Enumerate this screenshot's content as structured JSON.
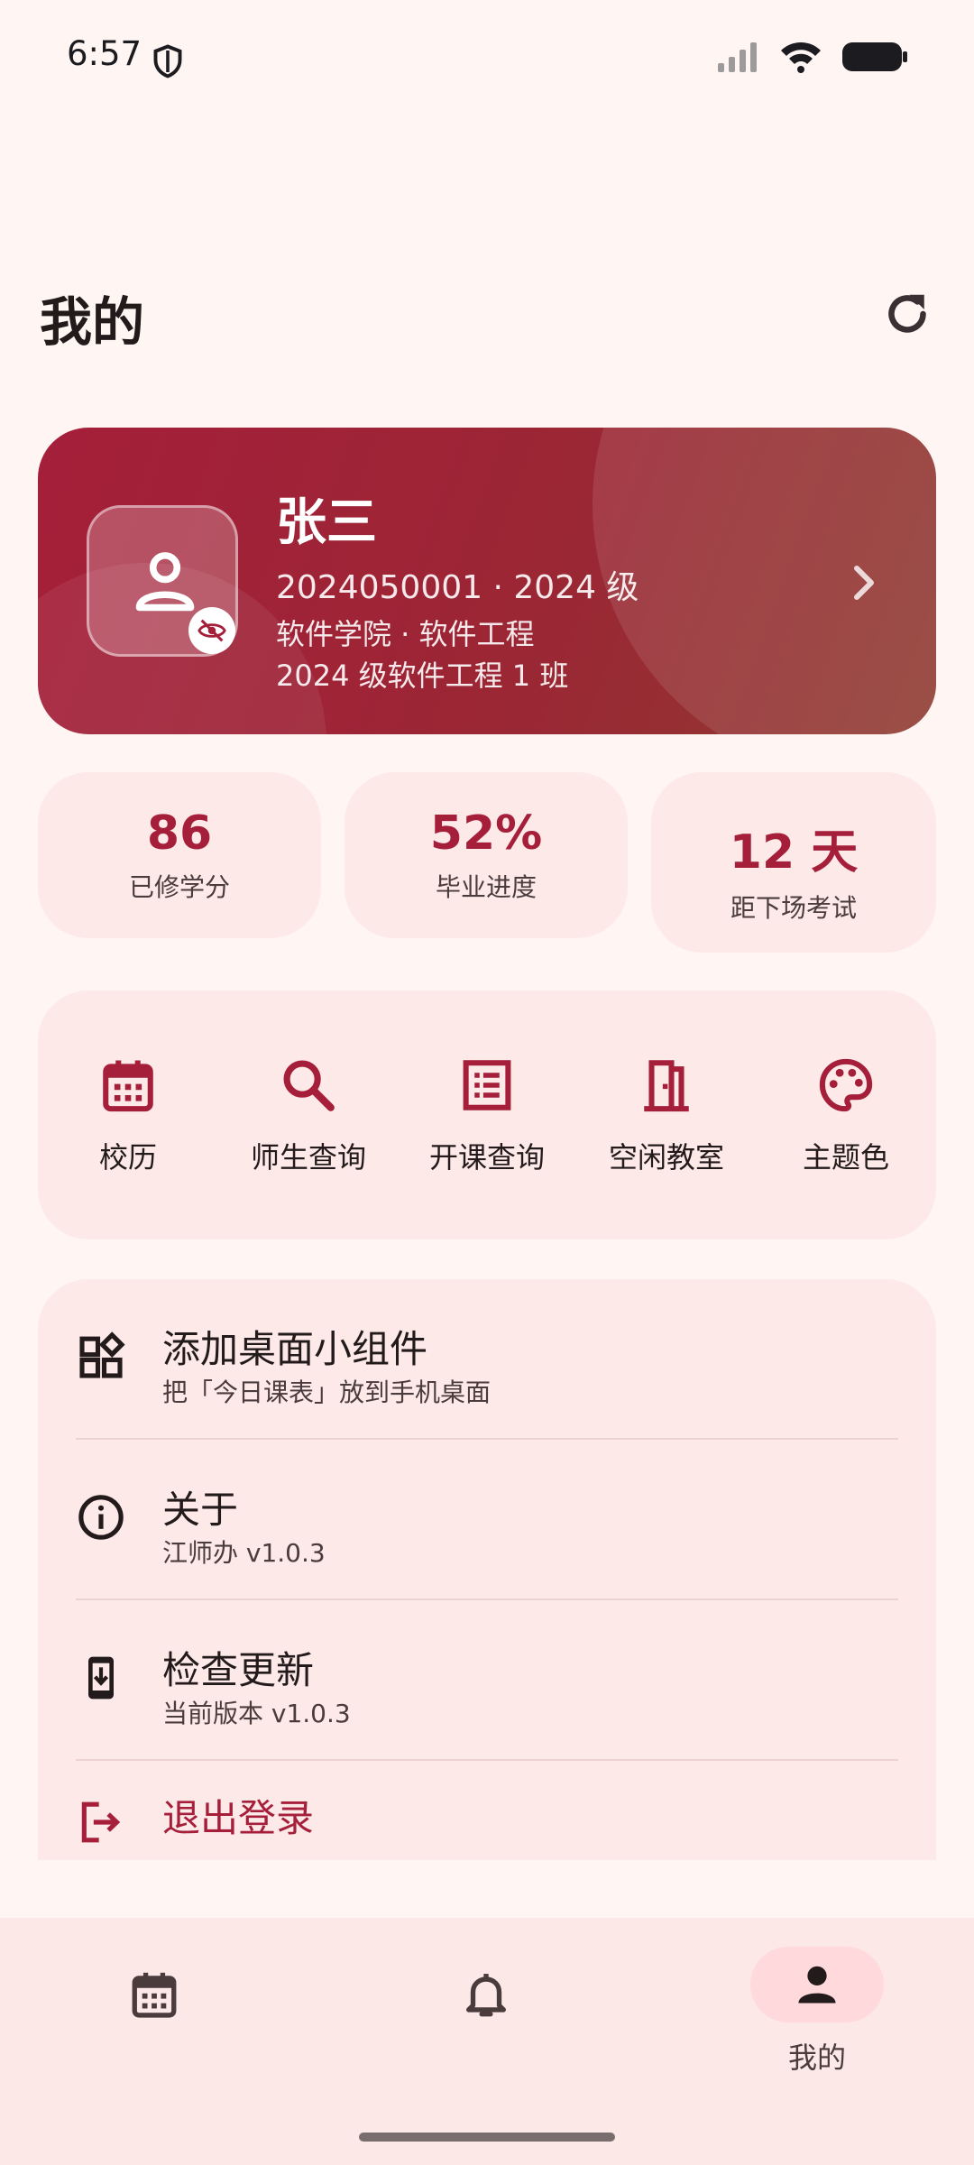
{
  "status_bar": {
    "time": "6:57"
  },
  "header": {
    "title": "我的"
  },
  "profile": {
    "name": "张三",
    "line1": "2024050001 · 2024 级",
    "line2": "软件学院 · 软件工程",
    "line3": "2024 级软件工程 1 班"
  },
  "stats": [
    {
      "value": "86",
      "label": "已修学分"
    },
    {
      "value": "52%",
      "label": "毕业进度"
    },
    {
      "value": "12 天",
      "label": "距下场考试"
    }
  ],
  "quick_actions": [
    {
      "label": "校历",
      "icon": "calendar-icon"
    },
    {
      "label": "师生查询",
      "icon": "search-icon"
    },
    {
      "label": "开课查询",
      "icon": "list-icon"
    },
    {
      "label": "空闲教室",
      "icon": "door-icon"
    },
    {
      "label": "主题色",
      "icon": "palette-icon"
    }
  ],
  "menu": [
    {
      "title": "添加桌面小组件",
      "subtitle": "把「今日课表」放到手机桌面",
      "icon": "widgets-icon"
    },
    {
      "title": "关于",
      "subtitle": "江师办 v1.0.3",
      "icon": "info-icon"
    },
    {
      "title": "检查更新",
      "subtitle": "当前版本 v1.0.3",
      "icon": "phone-download-icon"
    },
    {
      "title": "退出登录",
      "subtitle": "",
      "icon": "logout-icon"
    }
  ],
  "bottom_nav": {
    "items": [
      {
        "icon": "calendar-icon"
      },
      {
        "icon": "bell-icon"
      },
      {
        "icon": "person-icon",
        "label": "我的"
      }
    ]
  },
  "colors": {
    "accent": "#a51f3a",
    "background": "#fff5f3",
    "panel": "#fde9e8"
  }
}
